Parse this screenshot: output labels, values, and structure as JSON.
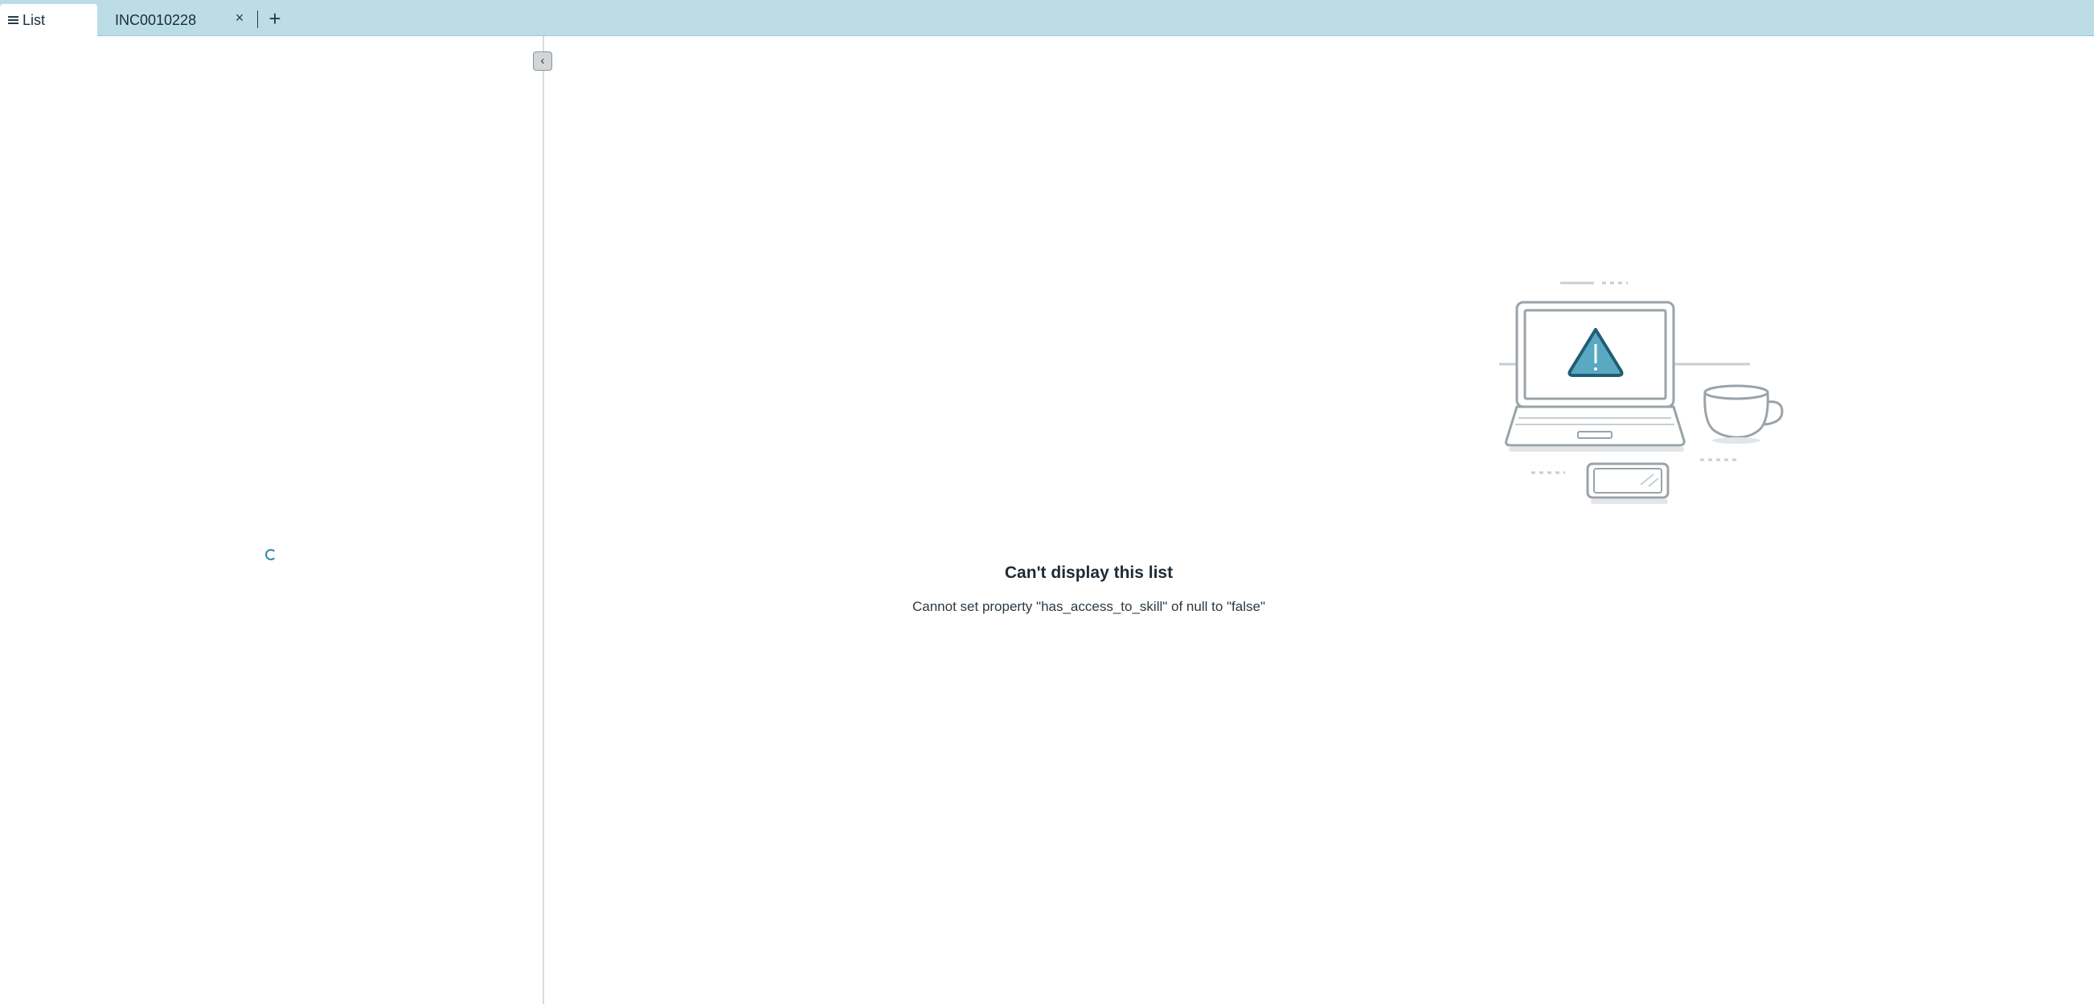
{
  "tabs": {
    "list_label": "List",
    "record_label": "INC0010228",
    "close_symbol": "×",
    "add_symbol": "+"
  },
  "sidebar": {
    "collapse_symbol": "‹"
  },
  "empty_state": {
    "title": "Can't display this list",
    "message": "Cannot set property \"has_access_to_skill\" of null to \"false\""
  },
  "colors": {
    "tab_strip": "#bcdde6",
    "accent": "#2f8cab",
    "warning_icon": "#5aa9c2"
  },
  "icons": {
    "menu": "menu-icon",
    "illustration": "laptop-warning-illustration"
  }
}
